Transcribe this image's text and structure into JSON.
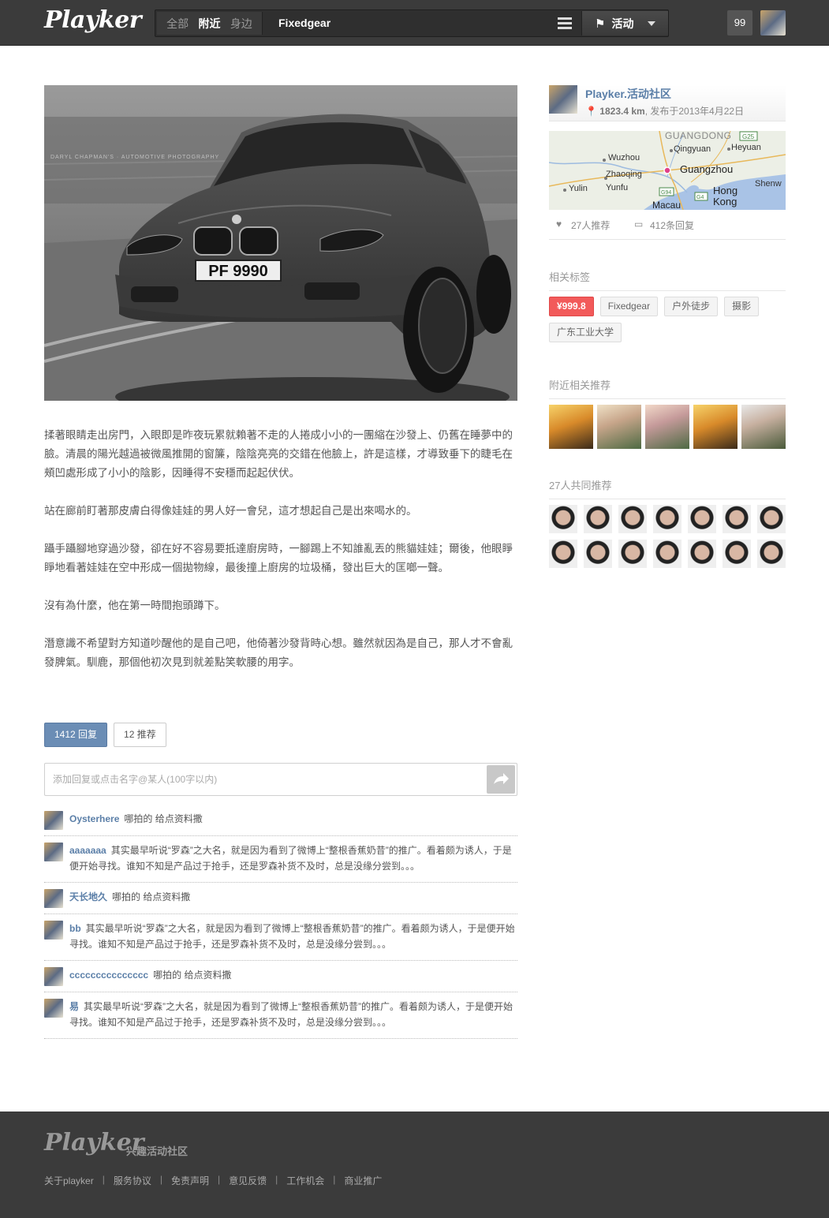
{
  "header": {
    "logo": "Playker",
    "scope": [
      "全部",
      "附近",
      "身边"
    ],
    "scope_active": 1,
    "search_value": "Fixedgear",
    "activity_label": "活动",
    "notification_count": "99"
  },
  "hero": {
    "watermark": "DARYL CHAPMAN'S · AUTOMOTIVE PHOTOGRAPHY",
    "plate": "PF 9990"
  },
  "article": {
    "paragraphs": [
      "揉著眼睛走出房門，入眼即是昨夜玩累就賴著不走的人捲成小小的一團縮在沙發上、仍舊在睡夢中的臉。清晨的陽光越過被微風推開的窗簾，陰陰亮亮的交錯在他臉上，許是這樣，才導致垂下的睫毛在頰凹處形成了小小的陰影，因睡得不安穩而起起伏伏。",
      "站在廊前盯著那皮膚白得像娃娃的男人好一會兒，這才想起自己是出來喝水的。",
      "躡手躡腳地穿過沙發，卻在好不容易要抵達廚房時，一腳踢上不知誰亂丟的熊貓娃娃；爾後，他眼睜睜地看著娃娃在空中形成一個拋物線，最後撞上廚房的垃圾桶，發出巨大的匡啷一聲。",
      "沒有為什麼，他在第一時間抱頭蹲下。",
      "潛意識不希望對方知道吵醒他的是自己吧，他倚著沙發背時心想。雖然就因為是自己，那人才不會亂發脾氣。馴鹿，那個他初次見到就差點笑軟腰的用字。"
    ]
  },
  "tabs": {
    "replies": "1412 回复",
    "recommends": "12 推荐"
  },
  "reply": {
    "placeholder": "添加回复或点击名字@某人(100字以内)"
  },
  "comments": [
    {
      "name": "Oysterhere",
      "text": "哪拍的 给点资料撒"
    },
    {
      "name": "aaaaaaa",
      "text": "其实最早听说“罗森”之大名，就是因为看到了微博上“整根香蕉奶昔”的推广。看着颇为诱人，于是便开始寻找。谁知不知是产品过于抢手，还是罗森补货不及时，总是没缘分尝到。。。"
    },
    {
      "name": "天长地久",
      "text": "哪拍的 给点资料撒"
    },
    {
      "name": "bb",
      "text": "其实最早听说“罗森”之大名，就是因为看到了微博上“整根香蕉奶昔”的推广。看着颇为诱人，于是便开始寻找。谁知不知是产品过于抢手，还是罗森补货不及时，总是没缘分尝到。。。"
    },
    {
      "name": "ccccccccccccccc",
      "text": "哪拍的 给点资料撒"
    },
    {
      "name": "易",
      "text": "其实最早听说“罗森”之大名，就是因为看到了微博上“整根香蕉奶昔”的推广。看着颇为诱人，于是便开始寻找。谁知不知是产品过于抢手，还是罗森补货不及时，总是没缘分尝到。。。"
    }
  ],
  "sidebar": {
    "community_name": "Playker.活动社区",
    "distance": "1823.4 km",
    "posted": ", 发布于2013年4月22日",
    "map_labels": {
      "guangdong": "GUANGDONG",
      "g25": "G25",
      "wuzhou": "Wuzhou",
      "qingyuan": "Qingyuan",
      "heyuan": "Heyuan",
      "zhaoqing": "Zhaoqing",
      "guangzhou": "Guangzhou",
      "yulin": "Yulin",
      "yunfu": "Yunfu",
      "g94": "G94",
      "hongkong1": "Hong",
      "hongkong2": "Kong",
      "shenzhen": "Shenw",
      "macau": "Macau",
      "g4": "G4"
    },
    "likes": "27人推荐",
    "reply_count": "412条回复",
    "tags_title": "相关标签",
    "tags": [
      "¥999.8",
      "Fixedgear",
      "户外徒步",
      "摄影",
      "广东工业大学"
    ],
    "nearby_title": "附近相关推荐",
    "common_title": "27人共同推荐"
  },
  "footer": {
    "logo": "Playker",
    "slogan": "兴趣活动社区",
    "links": [
      "关于playker",
      "服务协议",
      "免责声明",
      "意见反馈",
      "工作机会",
      "商业推广"
    ],
    "separator": "|"
  },
  "colors": {
    "header_bg": "#3b3b3b",
    "link_blue": "#5b7fa8",
    "tab_active": "#6b8db5",
    "price_tag": "#f25a5a"
  }
}
